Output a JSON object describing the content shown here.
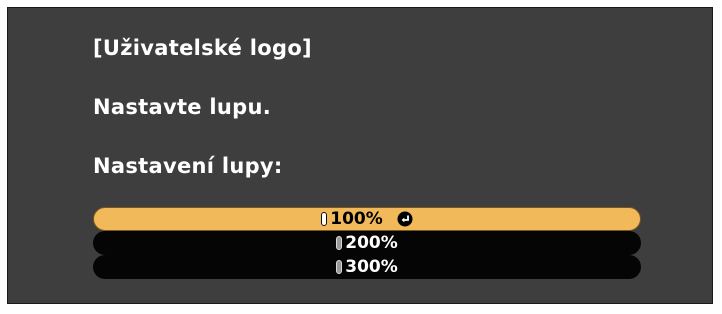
{
  "dialog": {
    "title": "[Uživatelské logo]",
    "instruction": "Nastavte lupu.",
    "setting_label": "Nastavení lupy:"
  },
  "zoom_options": [
    {
      "label": "100%",
      "selected": true
    },
    {
      "label": "200%",
      "selected": false
    },
    {
      "label": "300%",
      "selected": false
    }
  ],
  "colors": {
    "dialog_bg": "#3e3e3e",
    "selected_bg": "#f2b95a",
    "option_bg": "#050505",
    "text": "#ffffff"
  },
  "icons": {
    "confirm": "enter-icon"
  }
}
